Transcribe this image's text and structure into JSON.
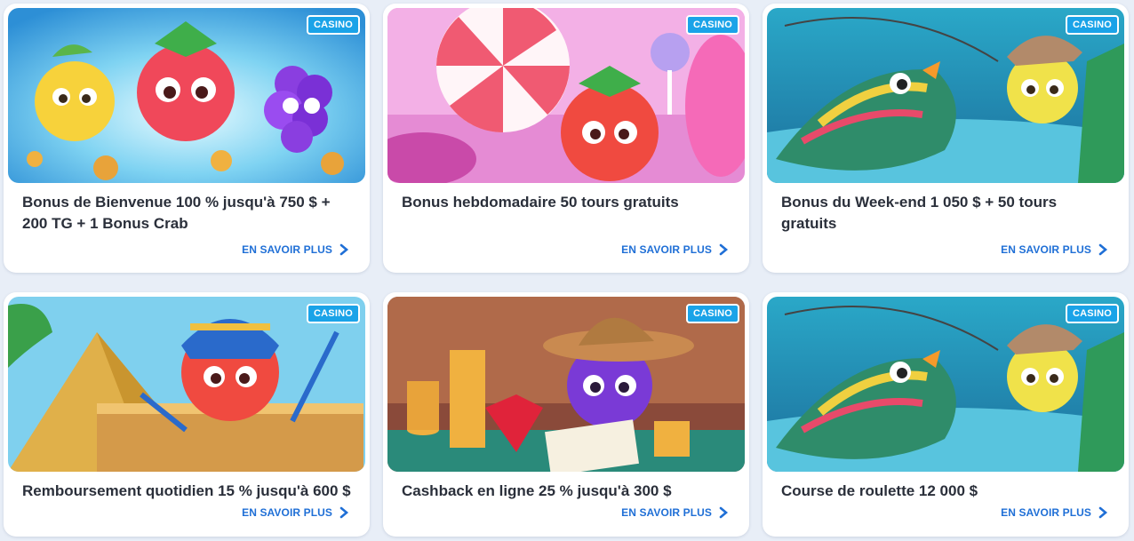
{
  "badge_label": "CASINO",
  "cta_label": "EN SAVOIR PLUS",
  "accent_color": "#1f6fd6",
  "badge_color": "#1aa3e8",
  "cards": [
    {
      "title": "Bonus de Bienvenue 100 % jusqu'à 750 $ + 200 TG + 1 Bonus Crab",
      "art": "fruits-coins-art"
    },
    {
      "title": "Bonus hebdomadaire 50 tours gratuits",
      "art": "candy-strawberry-art"
    },
    {
      "title": "Bonus du Week-end 1 050 $ + 50 tours gratuits",
      "art": "fishing-lemon-art"
    },
    {
      "title": "Remboursement quotidien 15 % jusqu'à 600 $",
      "art": "pharaoh-pyramid-art"
    },
    {
      "title": "Cashback en ligne 25 % jusqu'à 300 $",
      "art": "cowboy-gem-art"
    },
    {
      "title": "Course de roulette 12 000 $",
      "art": "fishing-lemon-art"
    }
  ]
}
